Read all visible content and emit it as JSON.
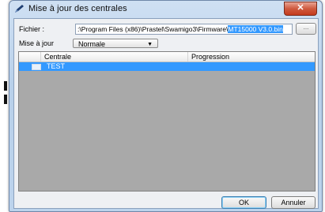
{
  "window": {
    "title": "Mise à jour des centrales",
    "close_glyph": "✕"
  },
  "file": {
    "label": "Fichier :",
    "path_prefix": ":\\Program Files (x86)\\Prastel\\Swamigo3\\Firmware\\",
    "path_selected": "MT15000 V3.0.bin",
    "browse_label": "..."
  },
  "update": {
    "label": "Mise à jour",
    "mode_value": "Normale",
    "arrow_glyph": "▼"
  },
  "table": {
    "columns": [
      "Centrale",
      "Progression"
    ],
    "rows": [
      {
        "name": "TEST",
        "checked": false,
        "progression": ""
      }
    ]
  },
  "buttons": {
    "ok": "OK",
    "cancel": "Annuler"
  },
  "colors": {
    "selection": "#3399ff",
    "list_background": "#a9a9a9",
    "close_button": "#c43a1d"
  },
  "icons": {
    "app": "pen-icon",
    "close": "close-icon"
  }
}
